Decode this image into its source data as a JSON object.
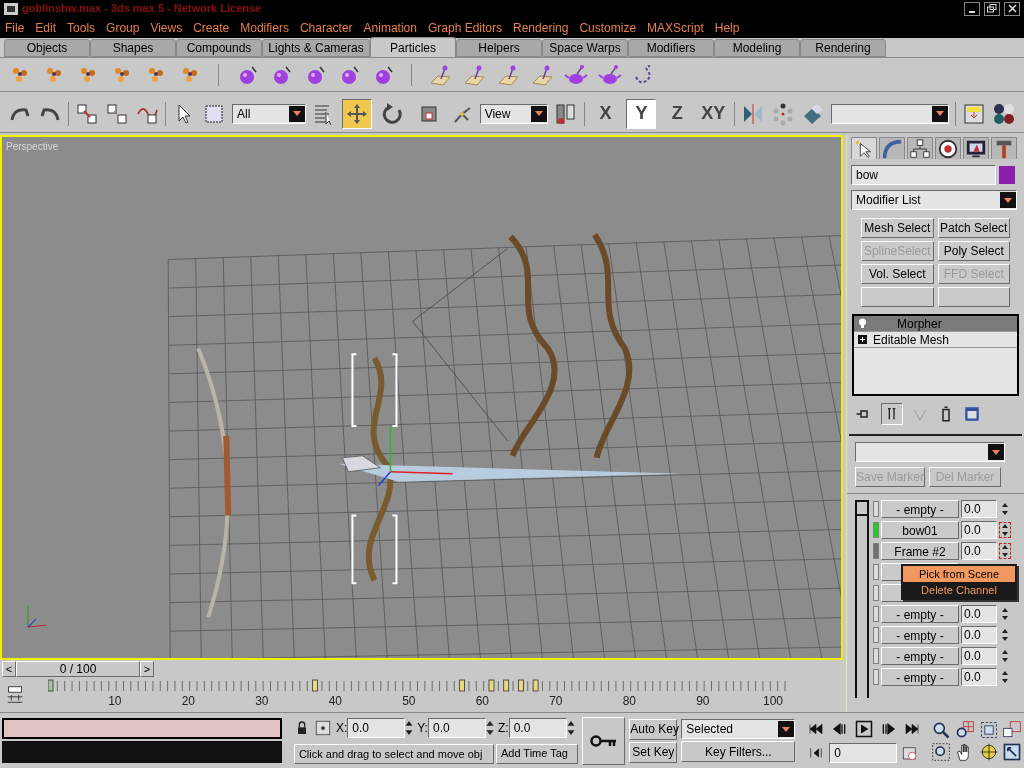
{
  "window": {
    "title": "goblinshw.max - 3ds max 5 - Network License"
  },
  "menu": [
    "File",
    "Edit",
    "Tools",
    "Group",
    "Views",
    "Create",
    "Modifiers",
    "Character",
    "Animation",
    "Graph Editors",
    "Rendering",
    "Customize",
    "MAXScript",
    "Help"
  ],
  "tab_panel": [
    {
      "label": "Objects",
      "selected": false
    },
    {
      "label": "Shapes",
      "selected": false
    },
    {
      "label": "Compounds",
      "selected": false
    },
    {
      "label": "Lights & Cameras",
      "selected": false
    },
    {
      "label": "Particles",
      "selected": true
    },
    {
      "label": "Helpers",
      "selected": false
    },
    {
      "label": "Space Warps",
      "selected": false
    },
    {
      "label": "Modifiers",
      "selected": false
    },
    {
      "label": "Modeling",
      "selected": false
    },
    {
      "label": "Rendering",
      "selected": false
    }
  ],
  "toolbar": {
    "selection_filter": "All",
    "coordinate_system": "View",
    "transform_tools": [
      {
        "kind": "move",
        "selected": true
      },
      {
        "kind": "rotate",
        "selected": false
      },
      {
        "kind": "scale",
        "selected": false
      }
    ],
    "constraints": [
      {
        "label": "X",
        "selected": false
      },
      {
        "label": "Y",
        "selected": true
      },
      {
        "label": "Z",
        "selected": false
      },
      {
        "label": "XY",
        "selected": false
      }
    ]
  },
  "viewport": {
    "label": "Perspective"
  },
  "time_slider": {
    "label": "0 / 100",
    "prev": "<",
    "next": ">"
  },
  "track_bar": {
    "ticks": [
      "10",
      "20",
      "30",
      "40",
      "50",
      "60",
      "70",
      "80",
      "90",
      "100"
    ]
  },
  "command_panel": {
    "tabs": [
      {
        "kind": "create",
        "selected": true
      },
      {
        "kind": "modify",
        "selected": false
      },
      {
        "kind": "hierarchy",
        "selected": false
      },
      {
        "kind": "motion",
        "selected": false
      },
      {
        "kind": "display",
        "selected": false
      },
      {
        "kind": "utilities",
        "selected": false
      }
    ],
    "object": {
      "name": "bow",
      "color": "#8e1fae"
    },
    "modifier_list": "Modifier List",
    "modifier_buttons": [
      {
        "label": "Mesh Select",
        "disabled": false
      },
      {
        "label": "Patch Select",
        "disabled": false
      },
      {
        "label": "SplineSelect",
        "disabled": true
      },
      {
        "label": "Poly Select",
        "disabled": false
      },
      {
        "label": "Vol. Select",
        "disabled": false
      },
      {
        "label": "FFD Select",
        "disabled": true
      }
    ],
    "stack": [
      {
        "label": "Morpher",
        "kind": "modifier",
        "selected": true
      },
      {
        "label": "Editable Mesh",
        "kind": "base",
        "selected": false
      }
    ],
    "morpher": {
      "save_marker": "Save Marker",
      "delete_marker": "Del Marker",
      "markers_disabled": true,
      "channels": [
        {
          "label": "- empty -",
          "value": "0.0",
          "color": "#dcdcdc",
          "animated": false
        },
        {
          "label": "bow01",
          "value": "0.0",
          "color": "#22cc22",
          "animated": true
        },
        {
          "label": "Frame #2",
          "value": "0.0",
          "color": "#707070",
          "animated": true
        },
        {
          "color": "#dcdcdc"
        },
        {
          "color": "#dcdcdc"
        },
        {
          "label": "- empty -",
          "value": "0.0",
          "color": "#dcdcdc",
          "animated": false
        },
        {
          "label": "- empty -",
          "value": "0.0",
          "color": "#dcdcdc",
          "animated": false
        },
        {
          "label": "- empty -",
          "value": "0.0",
          "color": "#dcdcdc",
          "animated": false
        },
        {
          "label": "- empty -",
          "value": "0.0",
          "color": "#dcdcdc",
          "animated": false
        }
      ]
    }
  },
  "context_menu": [
    {
      "label": "Pick from Scene",
      "selected": true
    },
    {
      "label": "Delete Channel",
      "selected": false
    }
  ],
  "status_bar": {
    "coords": [
      {
        "axis": "X:",
        "value": "0.0"
      },
      {
        "axis": "Y:",
        "value": "0.0"
      },
      {
        "axis": "Z:",
        "value": "0.0"
      }
    ],
    "prompt": "Click and drag to select and move obj",
    "add_time_tag": "Add Time Tag",
    "auto_key": "Auto Key",
    "set_key": "Set Key",
    "key_mode": "Selected",
    "key_filters": "Key Filters...",
    "current_frame": "0"
  }
}
